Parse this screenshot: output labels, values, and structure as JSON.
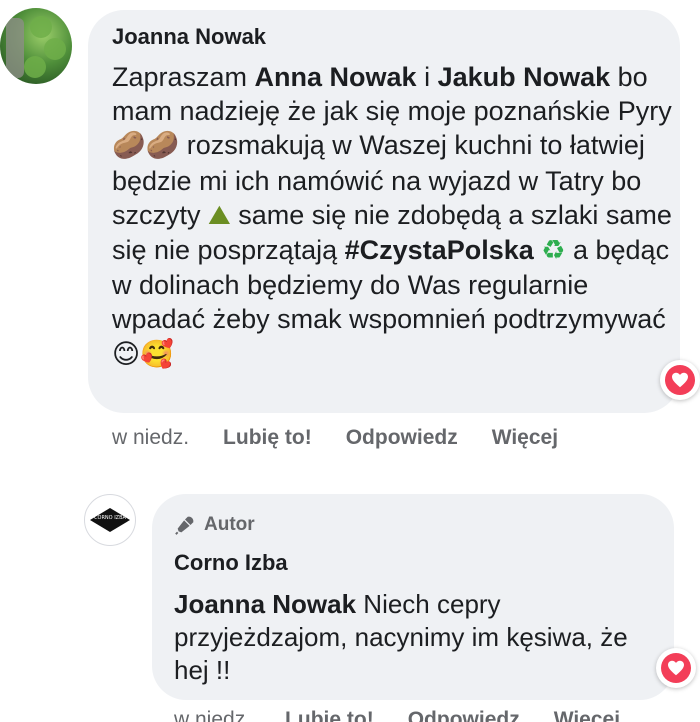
{
  "comment1": {
    "author": "Joanna Nowak",
    "text_start": "Zapraszam ",
    "mention1": "Anna Nowak",
    "connector": " i ",
    "mention2": "Jakub Nowak",
    "text_part2": " bo mam nadzieję że jak się moje poznańskie Pyry ",
    "text_part3": " rozsmakują w Waszej kuchni to łatwiej będzie mi ich namówić na wyjazd w Tatry bo szczyty ",
    "text_part4": " same się nie zdobędą a szlaki same się nie posprzątają ",
    "hashtag": "#CzystaPolska",
    "text_part5": " a będąc w dolinach będziemy do Was regularnie wpadać żeby smak wspomnień podtrzymywać ",
    "emoji_potatoes": "🥔🥔",
    "emoji_mountain": "⛰",
    "emoji_recycle": "♻",
    "emoji_end": "😊🥰",
    "time": "w niedz.",
    "like": "Lubię to!",
    "reply": "Odpowiedz",
    "more": "Więcej",
    "reaction_icon": "heart-icon"
  },
  "comment2": {
    "badge": "Autor",
    "author": "Corno Izba",
    "mention": "Joanna Nowak",
    "text": " Niech cepry przyjeżdzajom, nacynimy im kęsiwa, że hej !!",
    "avatar_text": "CORNO IZBA",
    "time": "w niedz.",
    "like": "Lubię to!",
    "reply": "Odpowiedz",
    "more": "Więcej",
    "reaction_icon": "heart-icon"
  },
  "colors": {
    "bubble": "#eff1f4",
    "heart": "#f33e58",
    "meta": "#65676b",
    "text": "#1c1e21"
  }
}
